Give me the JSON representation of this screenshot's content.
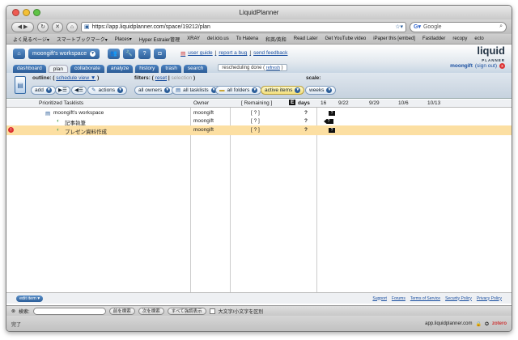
{
  "window": {
    "title": "LiquidPlanner"
  },
  "nav": {
    "url": "https://app.liquidplanner.com/space/19212/plan",
    "search_placeholder": "Google"
  },
  "bookmarks": [
    "よく見るページ▾",
    "スマートブックマーク▾",
    "Places▾",
    "Hyper Estraier管理",
    "XRAY",
    "del.icio.us",
    "To Hatena",
    "和英/英和",
    "Read Later",
    "Get YouTube video",
    "iPaper this [embed]",
    "Fastladder",
    "recopy",
    "ecto"
  ],
  "app": {
    "workspace_label": "moongift's workspace",
    "links": [
      "user guide",
      "|",
      "report a bug",
      "|",
      "send feedback"
    ],
    "logo": "liquid",
    "logo_sub": "PLANNER",
    "tabs": [
      "dashboard",
      "plan",
      "collaborate",
      "analyze",
      "history",
      "trash",
      "search"
    ],
    "active_tab": "plan",
    "rescheduling": "rescheduling done",
    "refresh": "refresh",
    "user": "moongift",
    "signout": "(sign out)"
  },
  "toolbar": {
    "outline_label": "outline:",
    "outline_link": "schedule view ▼",
    "filters_label": "filters:",
    "filters_reset": "reset",
    "filters_selection": "selection",
    "scale_label": "scale:",
    "add": "add",
    "actions": "actions",
    "all_owners": "all owners",
    "all_tasklists": "all tasklists",
    "all_folders": "all folders",
    "active_items": "active items",
    "weeks": "weeks"
  },
  "grid": {
    "headers": {
      "tasks": "Prioritized Tasklists",
      "owner": "Owner",
      "remaining": "[ Remaining ]",
      "e": "E",
      "days": "days"
    },
    "dates": [
      "16",
      "9/22",
      "9/29",
      "10/6",
      "10/13"
    ],
    "rows": [
      {
        "name": "moongift's workspace",
        "owner": "moongift",
        "remaining": "[ ? ]",
        "days": "?",
        "bar": "?"
      },
      {
        "name": "記事執筆",
        "owner": "moongift",
        "remaining": "[ ? ]",
        "days": "?",
        "bar": "?"
      },
      {
        "name": "プレゼン資料作成",
        "owner": "moongift",
        "remaining": "[ ? ]",
        "days": "?",
        "bar": "?"
      }
    ]
  },
  "bottom": {
    "edit_item": "edit item",
    "footer_links": [
      "Support",
      "Forums",
      "Terms of Service",
      "Security Policy",
      "Privacy Policy"
    ]
  },
  "findbar": {
    "label": "検索:",
    "prev": "前を検索",
    "next": "次を検索",
    "highlight": "すべて強調表示",
    "match_case": "大文字/小文字を区別"
  },
  "status": {
    "left": "完了",
    "host": "app.liquidplanner.com",
    "zotero": "zotero"
  }
}
